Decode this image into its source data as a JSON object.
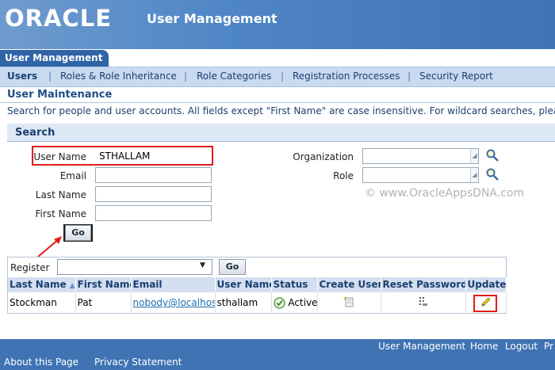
{
  "header": {
    "logo": "ORACLE",
    "app_title": "User Management"
  },
  "tabs": [
    {
      "label": "User Management"
    }
  ],
  "subnav": [
    {
      "label": "Users"
    },
    {
      "label": "Roles & Role Inheritance"
    },
    {
      "label": "Role Categories"
    },
    {
      "label": "Registration Processes"
    },
    {
      "label": "Security Report"
    }
  ],
  "page": {
    "title": "User Maintenance",
    "instructions": "Search for people and user accounts. All fields except \"First Name\" are case insensitive. For wildcard searches, please u"
  },
  "search": {
    "title": "Search",
    "fields": {
      "user_name": {
        "label": "User Name",
        "value": "STHALLAM"
      },
      "email": {
        "label": "Email",
        "value": ""
      },
      "last_name": {
        "label": "Last Name",
        "value": ""
      },
      "first_name": {
        "label": "First Name",
        "value": ""
      },
      "organization": {
        "label": "Organization",
        "value": ""
      },
      "role": {
        "label": "Role",
        "value": ""
      }
    },
    "go_label": "Go",
    "search_icon": "magnifier-icon"
  },
  "watermark": "© www.OracleAppsDNA.com",
  "results": {
    "register_label": "Register",
    "register_value": "",
    "go_label": "Go",
    "columns": [
      "Last Name",
      "First Name",
      "Email",
      "User Name",
      "Status",
      "Create User",
      "Reset Password",
      "Update"
    ],
    "rows": [
      {
        "last_name": "Stockman",
        "first_name": "Pat",
        "email": "nobody@localhost",
        "user_name": "sthallam",
        "status": "Active"
      }
    ]
  },
  "footer": {
    "links_right": [
      "User Management",
      "Home",
      "Logout",
      "Pr"
    ],
    "links_left": [
      "About this Page",
      "Privacy Statement"
    ]
  },
  "colors": {
    "header_blue": "#4f86c6",
    "tab_blue": "#2f64a6",
    "highlight_red": "#e31b1b"
  }
}
